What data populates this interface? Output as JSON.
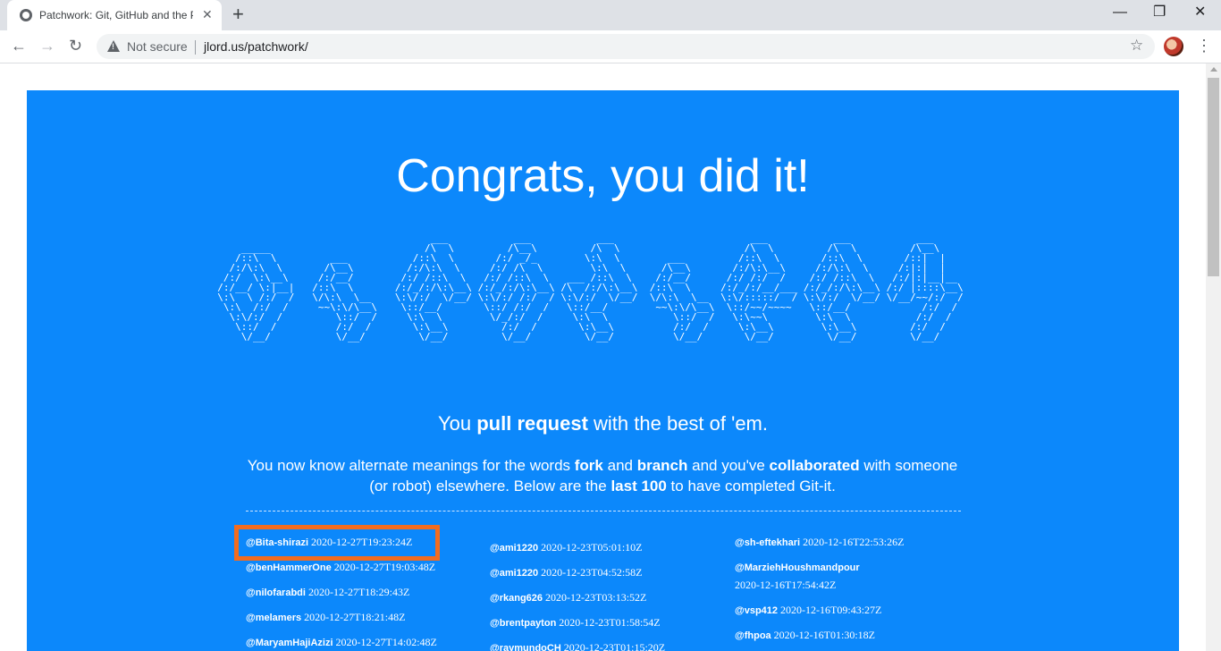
{
  "browser": {
    "tab_title": "Patchwork: Git, GitHub and the P",
    "tab_close": "✕",
    "new_tab": "+",
    "minimize": "—",
    "restore": "❐",
    "close": "✕",
    "back": "←",
    "forward": "→",
    "reload": "↻",
    "security_label": "Not secure",
    "url": "jlord.us/patchwork/",
    "star": "☆",
    "menu": "⋮",
    "icons": [
      "globe-icon",
      "warning-icon",
      "star-icon",
      "kebab-menu-icon"
    ]
  },
  "page": {
    "heading": "Congrats, you did it!",
    "ascii_art": "                                      ___           ___           ___                       ___           ___           ___     \n      _____                          /\\  \\         /\\__\\         /\\  \\                     /\\  \\         /\\  \\         /\\__\\    \n     /::\\  \\         ___           /::\\  \\       /:/ _/_        \\:\\  \\        ___         /::\\  \\       /::\\  \\       /::|  |   \n    /:/\\:\\  \\       /\\__\\         /:/\\:\\  \\     /:/ /\\  \\        \\:\\  \\      /\\__\\       /:/\\:\\__\\     /:/\\:\\  \\     /:|:|  |   \n   /:/  \\:\\__\\     /:/__/        /:/ /::\\  \\   /:/ /::\\  \\   ___ /::\\  \\    /:/__/      /:/ /:/  /    /:/ /::\\  \\   /:/|:|__|__ \n  /:/__/ \\:|__|   /::\\  \\       /:/_/:/\\:\\__\\ /:/_/:/\\:\\__\\ /\\  /:/\\:\\__\\  /::\\  \\     /:/_/:/__/___ /:/_/:/\\:\\__\\ /:/ |::::\\__\\\n  \\:\\  \\ /:/  /   \\/\\:\\  \\__    \\:\\/:/  \\/__/ \\:\\/:/ /:/  / \\:\\/:/  \\/__/  \\/\\:\\  \\__  \\:\\/:::::/  / \\:\\/:/  \\/__/ \\/__/~~/:/  /\n   \\:\\  /:/  /     ~~\\:\\/\\__\\    \\::/__/       \\::/ /:/  /   \\::/__/        ~~\\:\\/\\__\\  \\::/~~/~~~~   \\::/__/            /:/  / \n    \\:\\/:/  /         \\::/  /     \\:\\  \\        \\/_/:/  /     \\:\\  \\           \\::/  /   \\:\\~~\\        \\:\\  \\           /:/  /  \n     \\::/  /          /:/  /       \\:\\__\\         /:/  /       \\:\\__\\          /:/  /     \\:\\__\\        \\:\\__\\         /:/  /   \n      \\/__/           \\/__/         \\/__/         \\/__/         \\/__/          \\/__/       \\/__/         \\/__/         \\/__/    ",
    "subtitle_pre": "You ",
    "subtitle_bold": "pull request",
    "subtitle_post": " with the best of 'em.",
    "blurb": {
      "p1": "You now know alternate meanings for the words ",
      "b1": "fork",
      "p2": " and ",
      "b2": "branch",
      "p3": " and you've ",
      "b3": "collaborated",
      "p4": " with someone (or robot) elsewhere. Below are the ",
      "b4": "last 100",
      "p5": " to have completed Git-it."
    },
    "columns": [
      [
        {
          "user": "@Bita-shirazi",
          "time": "2020-12-27T19:23:24Z"
        },
        {
          "user": "@benHammerOne",
          "time": "2020-12-27T19:03:48Z"
        },
        {
          "user": "@nilofarabdi",
          "time": "2020-12-27T18:29:43Z"
        },
        {
          "user": "@melamers",
          "time": "2020-12-27T18:21:48Z"
        },
        {
          "user": "@MaryamHajiAzizi",
          "time": "2020-12-27T14:02:48Z"
        }
      ],
      [
        {
          "user": "@ami1220",
          "time": "2020-12-23T05:01:10Z"
        },
        {
          "user": "@ami1220",
          "time": "2020-12-23T04:52:58Z"
        },
        {
          "user": "@rkang626",
          "time": "2020-12-23T03:13:52Z"
        },
        {
          "user": "@brentpayton",
          "time": "2020-12-23T01:58:54Z"
        },
        {
          "user": "@raymundoCH",
          "time": "2020-12-23T01:15:20Z"
        }
      ],
      [
        {
          "user": "@sh-eftekhari",
          "time": "2020-12-16T22:53:26Z"
        },
        {
          "user": "@MarziehHoushmandpour",
          "time": "2020-12-16T17:54:42Z"
        },
        {
          "user": "@vsp412",
          "time": "2020-12-16T09:43:27Z"
        },
        {
          "user": "@fhpoa",
          "time": "2020-12-16T01:30:18Z"
        }
      ]
    ]
  }
}
